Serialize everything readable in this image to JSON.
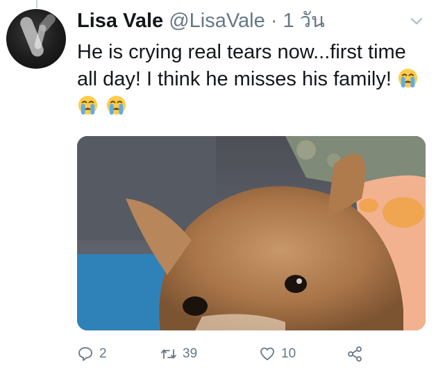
{
  "tweet": {
    "display_name": "Lisa Vale",
    "handle": "@LisaVale",
    "separator": "·",
    "timestamp": "1 วัน",
    "text": "He is crying real tears now...first time all day! I think he misses his family!",
    "emojis": [
      "crying-face",
      "crying-face",
      "crying-face"
    ],
    "media_description": "close-up photo of a tan chihuahua lying on a blue blanket"
  },
  "actions": {
    "reply_count": "2",
    "retweet_count": "39",
    "like_count": "10"
  },
  "colors": {
    "text_primary": "#14171a",
    "text_secondary": "#657786",
    "divider": "#ccd6dd"
  }
}
